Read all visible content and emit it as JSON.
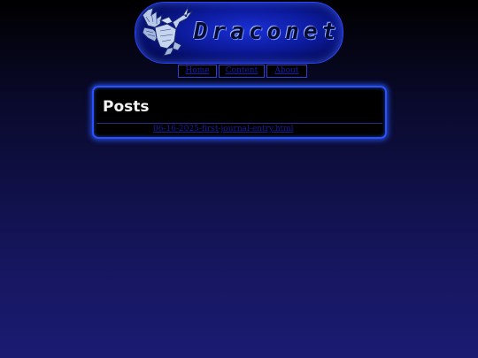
{
  "header": {
    "logo_text": "Draconet",
    "logo_icon": "dragon-icon"
  },
  "nav": {
    "items": [
      {
        "label": "Home"
      },
      {
        "label": "Content"
      },
      {
        "label": "About"
      }
    ]
  },
  "posts": {
    "title": "Posts",
    "items": [
      {
        "label": "06-16-2025-first-journal-entry.html"
      }
    ]
  },
  "colors": {
    "accent": "#2b50ff",
    "panel_bg": "#000000",
    "link": "#1a1a9e"
  }
}
